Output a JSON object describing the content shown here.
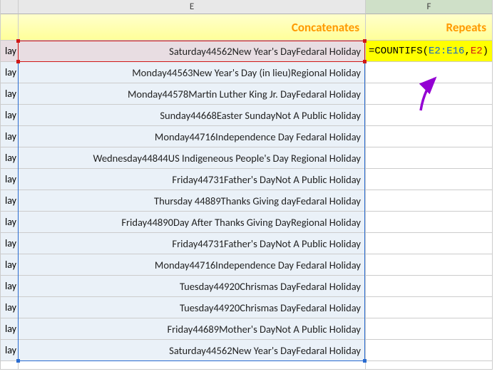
{
  "columns": {
    "d_letter": "",
    "e_letter": "E",
    "f_letter": "F"
  },
  "headers": {
    "e": "Concatenates",
    "f": "Repeats"
  },
  "truncated_d_suffix": "lay",
  "formula": {
    "prefix": "=COUNTIFS(",
    "arg1": "E2:E16",
    "comma": ",",
    "arg2": "E2",
    "suffix": ")"
  },
  "rows": [
    "Saturday44562New Year's DayFedaral Holiday",
    "Monday44563New Year's Day (in lieu)Regional Holiday",
    "Monday44578Martin Luther King Jr. DayFedaral Holiday",
    "Sunday44668Easter SundayNot A Public Holiday",
    "Monday44716Independence Day Fedaral Holiday",
    "Wednesday44844US Indigeneous People's Day Regional Holiday",
    "Friday44731Father's DayNot A Public Holiday",
    "Thursday 44889Thanks Giving dayFedaral Holiday",
    "Friday44890Day After Thanks Giving DayRegional Holiday",
    "Friday44731Father's DayNot A Public Holiday",
    "Monday44716Independence Day Fedaral Holiday",
    "Tuesday44920Chrismas DayFedaral Holiday",
    "Tuesday44920Chrismas DayFedaral Holiday",
    "Friday44689Mother's DayNot A Public Holiday",
    "Saturday44562New Year's DayFedaral Holiday"
  ]
}
